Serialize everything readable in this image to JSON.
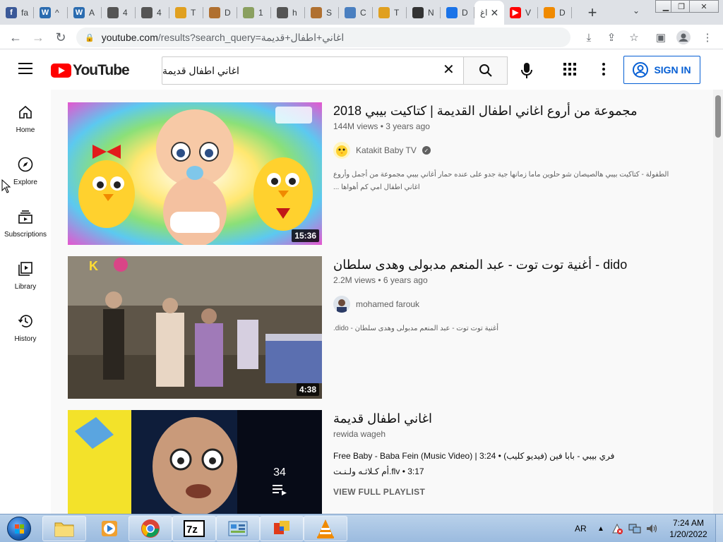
{
  "browser": {
    "tabs": [
      {
        "title": "fa",
        "fav_text": "f",
        "fav_color": "#3b5998"
      },
      {
        "title": "^",
        "fav_text": "W",
        "fav_color": "#2b6cb0"
      },
      {
        "title": "A",
        "fav_text": "W",
        "fav_color": "#2b6cb0"
      },
      {
        "title": "4",
        "fav_text": "",
        "fav_color": "#555555"
      },
      {
        "title": "4",
        "fav_text": "",
        "fav_color": "#555555"
      },
      {
        "title": "T",
        "fav_text": "",
        "fav_color": "#e0a020"
      },
      {
        "title": "D",
        "fav_text": "",
        "fav_color": "#b07030"
      },
      {
        "title": "1",
        "fav_text": "",
        "fav_color": "#8aa060"
      },
      {
        "title": "h",
        "fav_text": "",
        "fav_color": "#555555"
      },
      {
        "title": "S",
        "fav_text": "",
        "fav_color": "#b07030"
      },
      {
        "title": "C",
        "fav_text": "",
        "fav_color": "#4a7fc0"
      },
      {
        "title": "T",
        "fav_text": "",
        "fav_color": "#e0a020"
      },
      {
        "title": "N",
        "fav_text": "",
        "fav_color": "#333333"
      },
      {
        "title": "D",
        "fav_text": "",
        "fav_color": "#1a73e8"
      }
    ],
    "active_tab": {
      "title": "اغ",
      "close": "✕"
    },
    "tabs_after": [
      {
        "title": "V",
        "fav_text": "▶",
        "fav_color": "#ff0000"
      },
      {
        "title": "D",
        "fav_text": "",
        "fav_color": "#f08a00"
      }
    ],
    "new_tab": "+",
    "url_host": "youtube.com",
    "url_path": "/results?search_query=اغاني+اطفال+قديمة"
  },
  "youtube": {
    "logo_text": "YouTube",
    "search_value": "اغاني اطفال قديمة",
    "signin_label": "SIGN IN",
    "guide": [
      {
        "label": "Home",
        "icon": "home-icon"
      },
      {
        "label": "Explore",
        "icon": "compass-icon"
      },
      {
        "label": "Subscriptions",
        "icon": "subscriptions-icon"
      },
      {
        "label": "Library",
        "icon": "library-icon"
      },
      {
        "label": "History",
        "icon": "history-icon"
      }
    ],
    "results": [
      {
        "title": "مجموعة من أروع اغاني اطفال القديمة | كتاكيت بيبي 2018",
        "views": "144M views",
        "age": "3 years ago",
        "channel": "Katakit Baby TV",
        "verified": true,
        "desc": "الطفولة - كتاكيت بيبي هالصيصان شو حلوين ماما زمانها جية جدو على عنده حمار أغاني بيبي مجموعة من أجمل وأروع اغاني اطفال امي كم أهواها ...",
        "duration": "15:36"
      },
      {
        "title": "أغنية توت توت - عبد المنعم مدبولى وهدى سلطان - dido",
        "views": "2.2M views",
        "age": "6 years ago",
        "channel": "mohamed farouk",
        "desc": "أغنية توت توت - عبد المنعم مدبولى وهدى سلطان - dido.",
        "duration": "4:38"
      },
      {
        "title": "اغاني اطفال قديمة",
        "channel": "rewida wageh",
        "playlist_count": "34",
        "tracks": [
          {
            "name": "Free Baby - Baba Fein (Music Video) | فري بيبي - بابا فين (فيديو كليب)",
            "time": "3:24"
          },
          {
            "name": "أم كـلاثـه ولـنـت.flv",
            "time": "3:17"
          }
        ],
        "view_full": "VIEW FULL PLAYLIST"
      }
    ]
  },
  "taskbar": {
    "lang": "AR",
    "time": "7:24 AM",
    "date": "1/20/2022"
  }
}
